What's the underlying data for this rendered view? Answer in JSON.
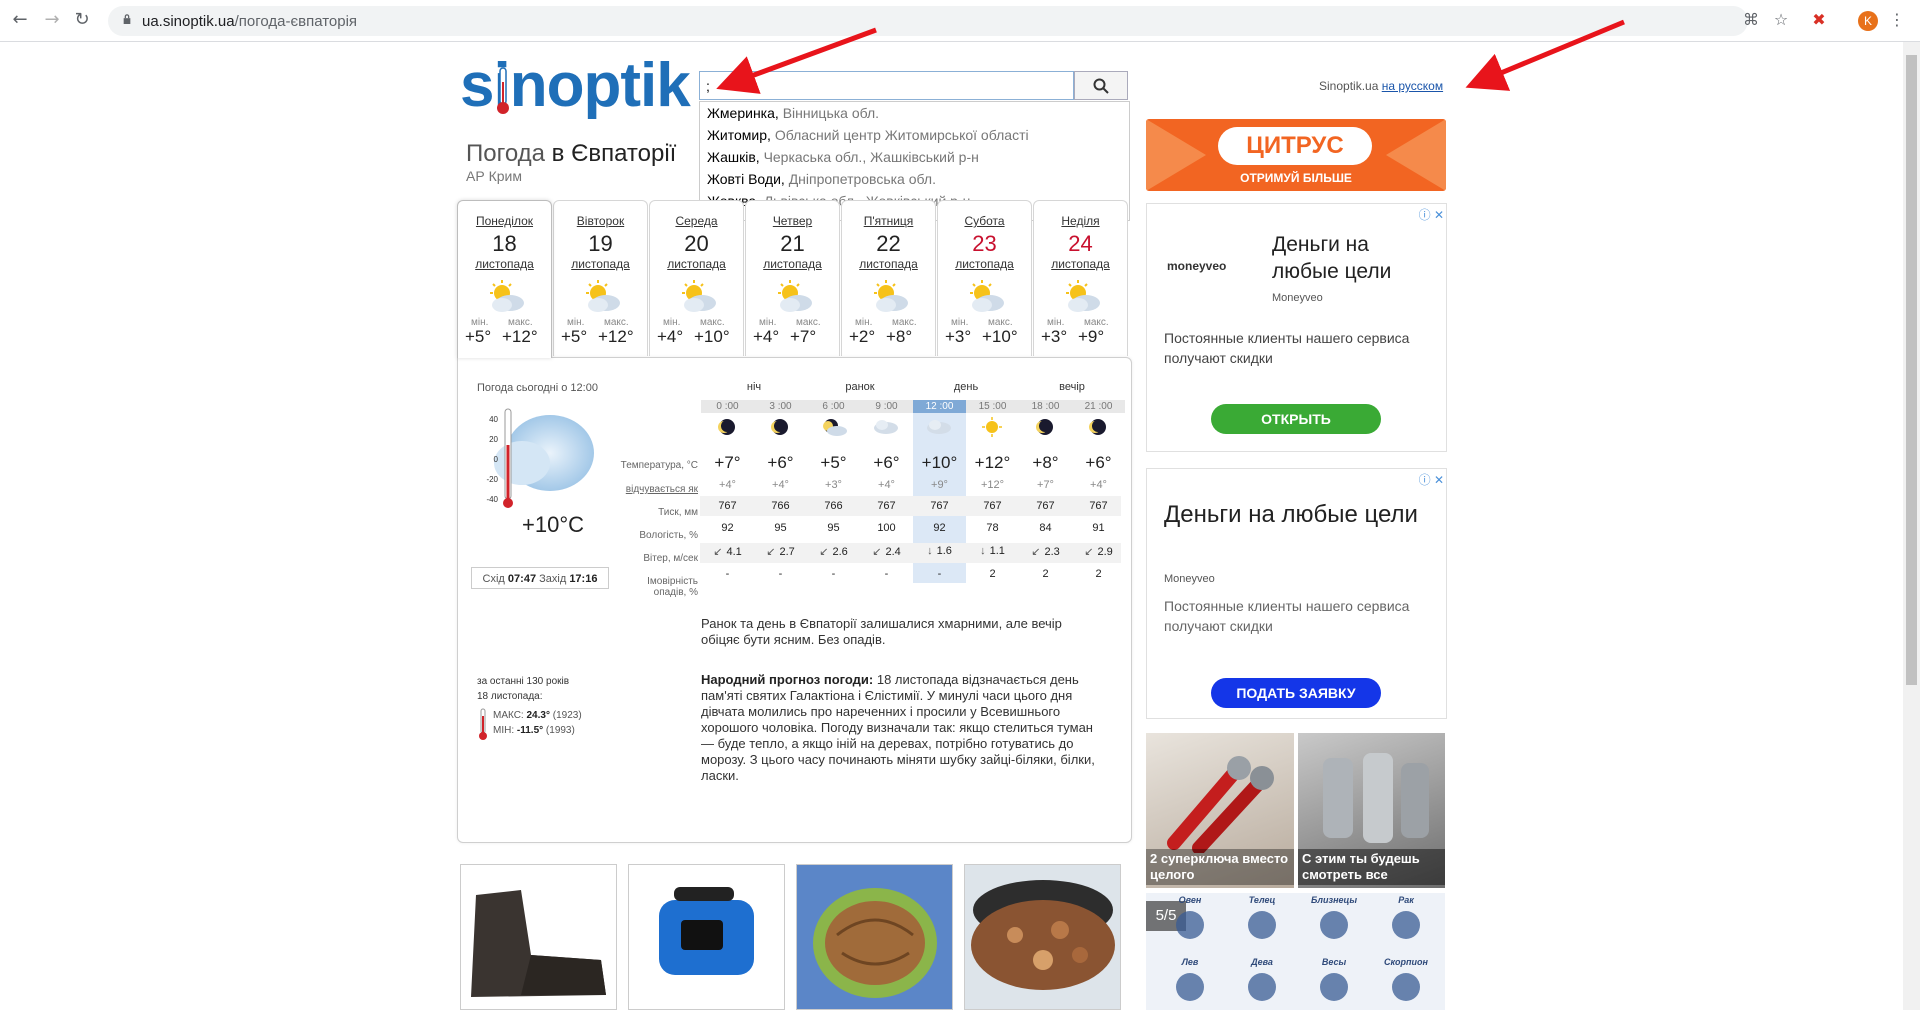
{
  "browser": {
    "url_host": "ua.sinoptik.ua",
    "url_path": "/погода-євпаторія",
    "avatar_letter": "K"
  },
  "site": {
    "logo": "sinoptik",
    "lang_prefix": "Sinoptik.ua",
    "lang_link": "на русском"
  },
  "search": {
    "value": ";",
    "suggestions": [
      {
        "city": "Жмеринка",
        "region": "Вінницька обл."
      },
      {
        "city": "Житомир",
        "region": "Обласний центр Житомирської області"
      },
      {
        "city": "Жашків",
        "region": "Черкаська обл., Жашківський р-н"
      },
      {
        "city": "Жовті Води",
        "region": "Дніпропетровська обл."
      },
      {
        "city": "Жовква",
        "region": "Львівська обл., Жовківський р-н"
      }
    ]
  },
  "city": {
    "prefix": "Погода",
    "name": "в Євпаторії",
    "region": "АР Крим"
  },
  "days": [
    {
      "name": "Понеділок",
      "num": "18",
      "month": "листопада",
      "min": "+5°",
      "max": "+12°",
      "weekend": false
    },
    {
      "name": "Вівторок",
      "num": "19",
      "month": "листопада",
      "min": "+5°",
      "max": "+12°",
      "weekend": false
    },
    {
      "name": "Середа",
      "num": "20",
      "month": "листопада",
      "min": "+4°",
      "max": "+10°",
      "weekend": false
    },
    {
      "name": "Четвер",
      "num": "21",
      "month": "листопада",
      "min": "+4°",
      "max": "+7°",
      "weekend": false
    },
    {
      "name": "П'ятниця",
      "num": "22",
      "month": "листопада",
      "min": "+2°",
      "max": "+8°",
      "weekend": false
    },
    {
      "name": "Субота",
      "num": "23",
      "month": "листопада",
      "min": "+3°",
      "max": "+10°",
      "weekend": true
    },
    {
      "name": "Неділя",
      "num": "24",
      "month": "листопада",
      "min": "+3°",
      "max": "+9°",
      "weekend": true
    }
  ],
  "labels": {
    "min": "мін.",
    "max": "макс."
  },
  "now": {
    "title": "Погода сьогодні о 12:00",
    "temp": "+10°C",
    "scale": [
      "40",
      "20",
      "0",
      "-20",
      "-40"
    ],
    "sunrise_label": "Схід",
    "sunrise": "07:47",
    "sunset_label": "Захід",
    "sunset": "17:16"
  },
  "periods": [
    "ніч",
    "ранок",
    "день",
    "вечір"
  ],
  "hours": [
    "0 :00",
    "3 :00",
    "6 :00",
    "9 :00",
    "12 :00",
    "15 :00",
    "18 :00",
    "21 :00"
  ],
  "row_labels": {
    "temp": "Температура, °С",
    "feels": "відчувається як",
    "pressure": "Тиск, мм",
    "humidity": "Вологість, %",
    "wind": "Вітер, м/сек",
    "precip_1": "Імовірність",
    "precip_2": "опадів, %"
  },
  "hourly": {
    "temp": [
      "+7°",
      "+6°",
      "+5°",
      "+6°",
      "+10°",
      "+12°",
      "+8°",
      "+6°"
    ],
    "feels": [
      "+4°",
      "+4°",
      "+3°",
      "+4°",
      "+9°",
      "+12°",
      "+7°",
      "+4°"
    ],
    "pressure": [
      "767",
      "766",
      "766",
      "767",
      "767",
      "767",
      "767",
      "767"
    ],
    "humidity": [
      "92",
      "95",
      "95",
      "100",
      "92",
      "78",
      "84",
      "91"
    ],
    "wind_dir": [
      "↙",
      "↙",
      "↙",
      "↙",
      "↓",
      "↓",
      "↙",
      "↙"
    ],
    "wind": [
      "4.1",
      "2.7",
      "2.6",
      "2.4",
      "1.6",
      "1.1",
      "2.3",
      "2.9"
    ],
    "precip": [
      "-",
      "-",
      "-",
      "-",
      "-",
      "2",
      "2",
      "2"
    ]
  },
  "description": "Ранок та день в Євпаторії залишалися хмарними, але вечір обіцяє бути ясним. Без опадів.",
  "folk": {
    "title": "Народний прогноз погоди:",
    "text": " 18 листопада відзначається день пам'яті святих Галактіона і Єлістимії. У минулі часи цього дня дівчата молились про нареченних і просили у Всевишнього хорошого чоловіка. Погоду визначали так: якщо стелиться туман — буде тепло, а якщо іній на деревах, потрібно готуватись до морозу. З цього часу починають міняти шубку зайці-біляки, білки, ласки."
  },
  "history": {
    "line1": "за останні 130 років",
    "line2": "18 листопада:",
    "max_label": "МАКС:",
    "max": "24.3°",
    "max_year": "(1923)",
    "min_label": "МІН:",
    "min": "-11.5°",
    "min_year": "(1993)"
  },
  "ads": {
    "citrus_brand": "ЦИТРУС",
    "citrus_sub": "ОТРИМУЙ БІЛЬШЕ",
    "ad1_logo": "moneyveo",
    "ad1_title": "Деньги на любые цели",
    "ad1_source": "Moneyveo",
    "ad1_text": "Постоянные клиенты нашего сервиса получают скидки",
    "ad1_button": "ОТКРЫТЬ",
    "ad2_title": "Деньги на любые цели",
    "ad2_source": "Moneyveo",
    "ad2_text": "Постоянные клиенты нашего сервиса получают скидки",
    "ad2_button": "ПОДАТЬ ЗАЯВКУ",
    "thumb1": "2 суперключа вместо целого",
    "thumb2": "С этим ты будешь смотреть все",
    "counter": "5/5",
    "zodiac": [
      "Овен",
      "Телец",
      "Близнецы",
      "Рак",
      "Лев",
      "Дева",
      "Весы",
      "Скорпион"
    ]
  },
  "colors": {
    "brand_blue": "#1f6fb8",
    "weekend_red": "#c8102e",
    "citrus_orange": "#f26522",
    "open_green": "#3aaa35",
    "apply_blue": "#1436e8"
  }
}
